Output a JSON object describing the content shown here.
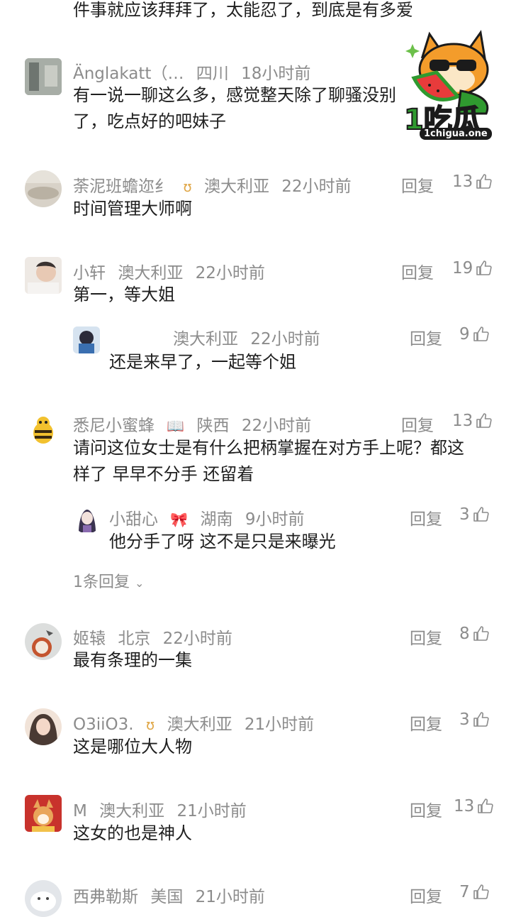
{
  "top_text": "件事就应该拜拜了，太能忍了，到底是有多爱",
  "reply_label": "回复",
  "comments": [
    {
      "user": "Änglakatt（…",
      "location": "四川",
      "time": "18小时前",
      "text_lines": [
        "有一说一聊这么多，感觉整天除了聊骚没别",
        "了，吃点好的吧妹子"
      ],
      "likes": ""
    },
    {
      "user": "荼泥班蟾迩纟",
      "location": "澳大利亚",
      "time": "22小时前",
      "text_lines": [
        "时间管理大师啊"
      ],
      "likes": "13"
    },
    {
      "user": "小轩",
      "location": "澳大利亚",
      "time": "22小时前",
      "text_lines": [
        "第一，等大姐"
      ],
      "likes": "19"
    },
    {
      "user": "",
      "location": "澳大利亚",
      "time": "22小时前",
      "text_lines": [
        "还是来早了，一起等个姐"
      ],
      "likes": "9"
    },
    {
      "user": "悉尼小蜜蜂",
      "location": "陕西",
      "time": "22小时前",
      "text_lines": [
        "请问这位女士是有什么把柄掌握在对方手上呢？都这",
        "样了 早早不分手 还留着"
      ],
      "likes": "13"
    },
    {
      "user": "小甜心",
      "location": "湖南",
      "time": "9小时前",
      "text_lines": [
        "他分手了呀 这不是只是来曝光"
      ],
      "likes": "3"
    },
    {
      "user": "姬辕",
      "location": "北京",
      "time": "22小时前",
      "text_lines": [
        "最有条理的一集"
      ],
      "likes": "8"
    },
    {
      "user": "O3iiO3.",
      "location": "澳大利亚",
      "time": "21小时前",
      "text_lines": [
        "这是哪位大人物"
      ],
      "likes": "3"
    },
    {
      "user": "M",
      "location": "澳大利亚",
      "time": "21小时前",
      "text_lines": [
        "这女的也是神人"
      ],
      "likes": "13"
    },
    {
      "user": "西弗勒斯",
      "location": "美国",
      "time": "21小时前",
      "text_lines": [],
      "likes": "7"
    }
  ],
  "more_replies": "1条回复",
  "watermark": {
    "brand": "1吃瓜",
    "url": "1chigua.one"
  },
  "colors": {
    "meta": "#8c8c8c",
    "text": "#1f1f1f",
    "logo_green": "#2f9a2f",
    "logo_orange": "#f39c2b"
  }
}
